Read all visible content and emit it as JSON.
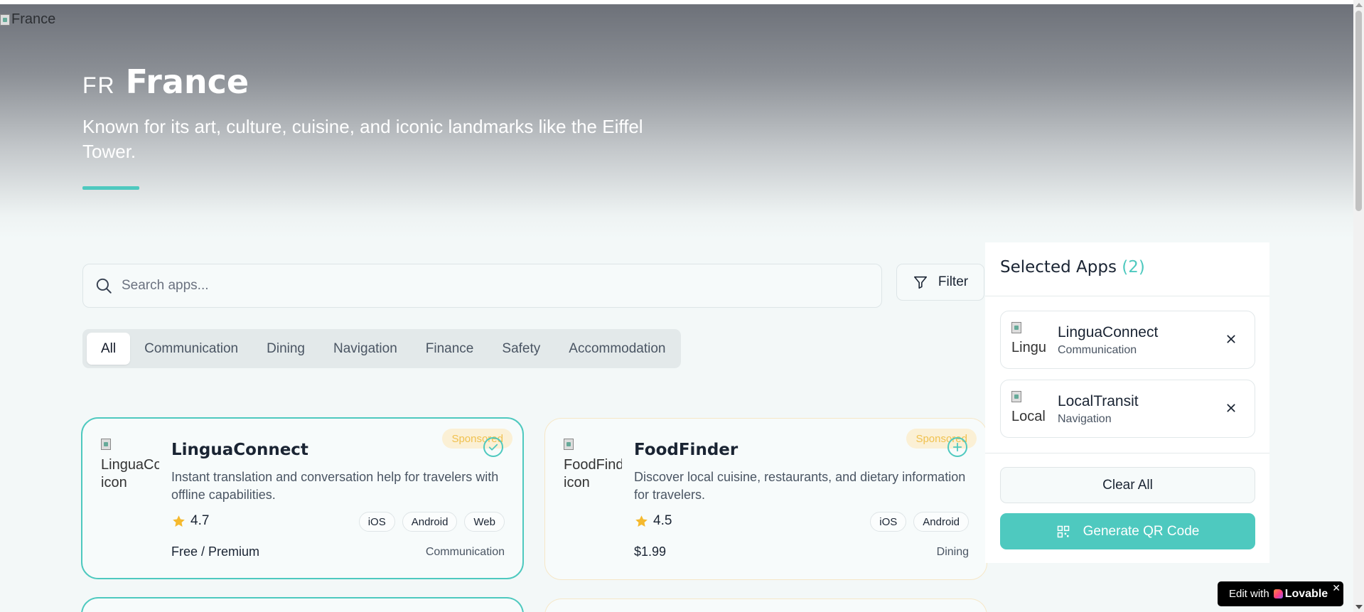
{
  "hero": {
    "image_alt": "France",
    "country_code": "FR",
    "country_name": "France",
    "description": "Known for its art, culture, cuisine, and iconic landmarks like the Eiffel Tower."
  },
  "search": {
    "placeholder": "Search apps...",
    "value": ""
  },
  "filter_label": "Filter",
  "tabs": [
    "All",
    "Communication",
    "Dining",
    "Navigation",
    "Finance",
    "Safety",
    "Accommodation"
  ],
  "active_tab": "All",
  "apps": [
    {
      "icon_alt": "LinguaConnect icon",
      "name": "LinguaConnect",
      "description": "Instant translation and conversation help for travelers with offline capabilities.",
      "rating": "4.7",
      "platforms": [
        "iOS",
        "Android",
        "Web"
      ],
      "price": "Free / Premium",
      "category": "Communication",
      "badge": "Sponsored",
      "selected": true
    },
    {
      "icon_alt": "FoodFinder icon",
      "name": "FoodFinder",
      "description": "Discover local cuisine, restaurants, and dietary information for travelers.",
      "rating": "4.5",
      "platforms": [
        "iOS",
        "Android"
      ],
      "price": "$1.99",
      "category": "Dining",
      "badge": "Sponsored",
      "selected": false
    }
  ],
  "selected_panel": {
    "title": "Selected Apps",
    "count": "(2)",
    "items": [
      {
        "icon_alt": "Lingu",
        "name": "LinguaConnect",
        "category": "Communication"
      },
      {
        "icon_alt": "Local",
        "name": "LocalTransit",
        "category": "Navigation"
      }
    ],
    "clear_label": "Clear All",
    "generate_label": "Generate QR Code"
  },
  "lovable_badge": {
    "prefix": "Edit with",
    "brand": "Lovable",
    "close": "✕"
  },
  "colors": {
    "accent": "#4ec9bf",
    "sponsored_text": "#f0c14f",
    "sponsored_bg": "#fbf0d5",
    "star": "#f5b92e"
  },
  "icons": {
    "search": "search-icon",
    "filter": "filter-icon",
    "star": "star-icon",
    "check": "check-circle-icon",
    "add": "plus-circle-icon",
    "close": "close-icon",
    "qr": "qr-code-icon"
  }
}
